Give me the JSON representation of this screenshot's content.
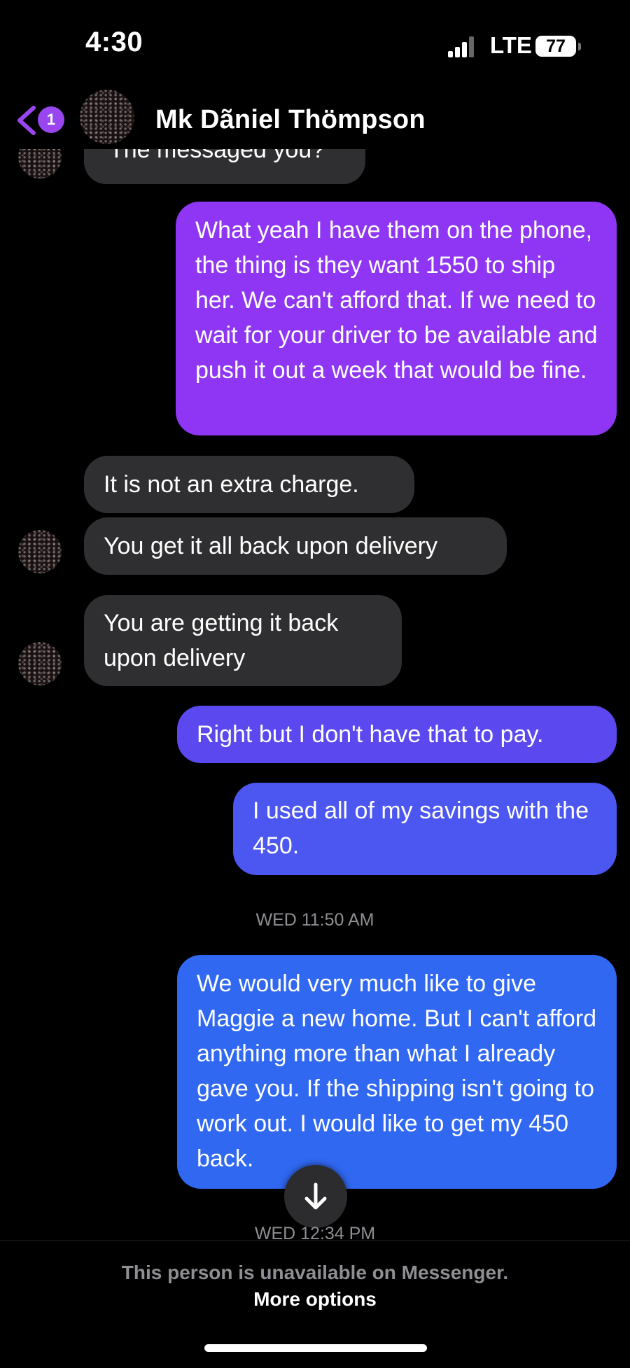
{
  "status_bar": {
    "time": "4:30",
    "network": "LTE",
    "battery": "77"
  },
  "header": {
    "unread_count": "1",
    "contact_name": "Mk Dãniel Thömpson"
  },
  "messages": [
    {
      "text": "The messaged you?"
    },
    {
      "text": "What yeah I have them on the phone, the thing is they want 1550 to ship her. We can't afford that. If we need to wait for your driver to be available and push it out a week that would be fine."
    },
    {
      "text": "It is not an extra charge."
    },
    {
      "text": "You get it all back upon delivery"
    },
    {
      "text": "You are getting it back upon delivery"
    },
    {
      "text": "Right but I don't have that to pay."
    },
    {
      "text": "I used all of my savings with the 450."
    },
    {
      "text": "We would very much like to give Maggie a new home. But I can't afford anything more than what I already gave you. If the shipping isn't going to work out. I would like to get my 450 back."
    }
  ],
  "timestamps": [
    "WED 11:50 AM",
    "WED 12:34 PM"
  ],
  "footer": {
    "note": "This person is unavailable on Messenger.",
    "more_options": "More options"
  },
  "colors": {
    "sent_top": "#8e36f3",
    "sent_mid": "#5b49ef",
    "sent_bottom": "#3068f2",
    "received": "#2f2f31",
    "accent": "#9a46f0"
  },
  "icons": {
    "back": "chevron-left-icon",
    "scroll": "arrow-down-icon"
  }
}
